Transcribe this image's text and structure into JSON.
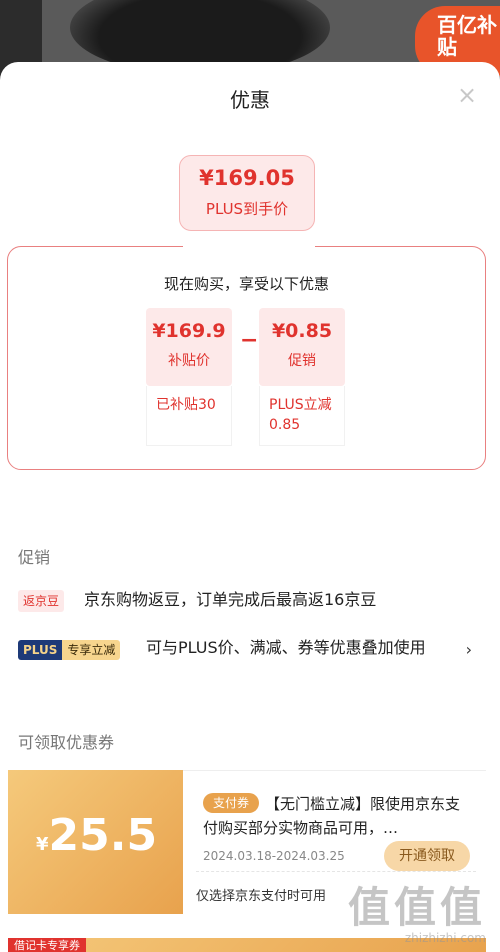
{
  "background": {
    "badge_text": "百亿补贴"
  },
  "sheet": {
    "title": "优惠",
    "close_glyph": "×"
  },
  "final_price": {
    "price": "¥169.05",
    "label": "PLUS到手价"
  },
  "breakdown": {
    "heading": "现在购买，享受以下优惠",
    "operator": "−",
    "items": [
      {
        "value": "¥169.9",
        "label": "补贴价",
        "note": "已补贴30"
      },
      {
        "value": "¥0.85",
        "label": "促销",
        "note": "PLUS立减0.85"
      }
    ]
  },
  "promotions": {
    "title": "促销",
    "items": [
      {
        "tag": "返京豆",
        "text": "京东购物返豆，订单完成后最高返16京豆"
      },
      {
        "tag_a": "PLUS",
        "tag_b": "专享立减",
        "text": "可与PLUS价、满减、券等优惠叠加使用",
        "chevron": "›"
      }
    ]
  },
  "coupons": {
    "title": "可领取优惠券",
    "items": [
      {
        "currency": "¥",
        "amount": "25.5",
        "type_tag": "支付券",
        "description": "【无门槛立减】限使用京东支付购买部分实物商品可用，…",
        "date_range": "2024.03.18-2024.03.25",
        "claim_label": "开通领取",
        "condition": "仅选择京东支付时可用"
      }
    ],
    "next_tag": "借记卡专享券"
  },
  "watermark": {
    "big": "值值值",
    "small": "zhizhizhi.com"
  },
  "colors": {
    "accent_red": "#e0332e",
    "coupon_gold": "#e8a24d",
    "plus_navy": "#1e3a78"
  }
}
